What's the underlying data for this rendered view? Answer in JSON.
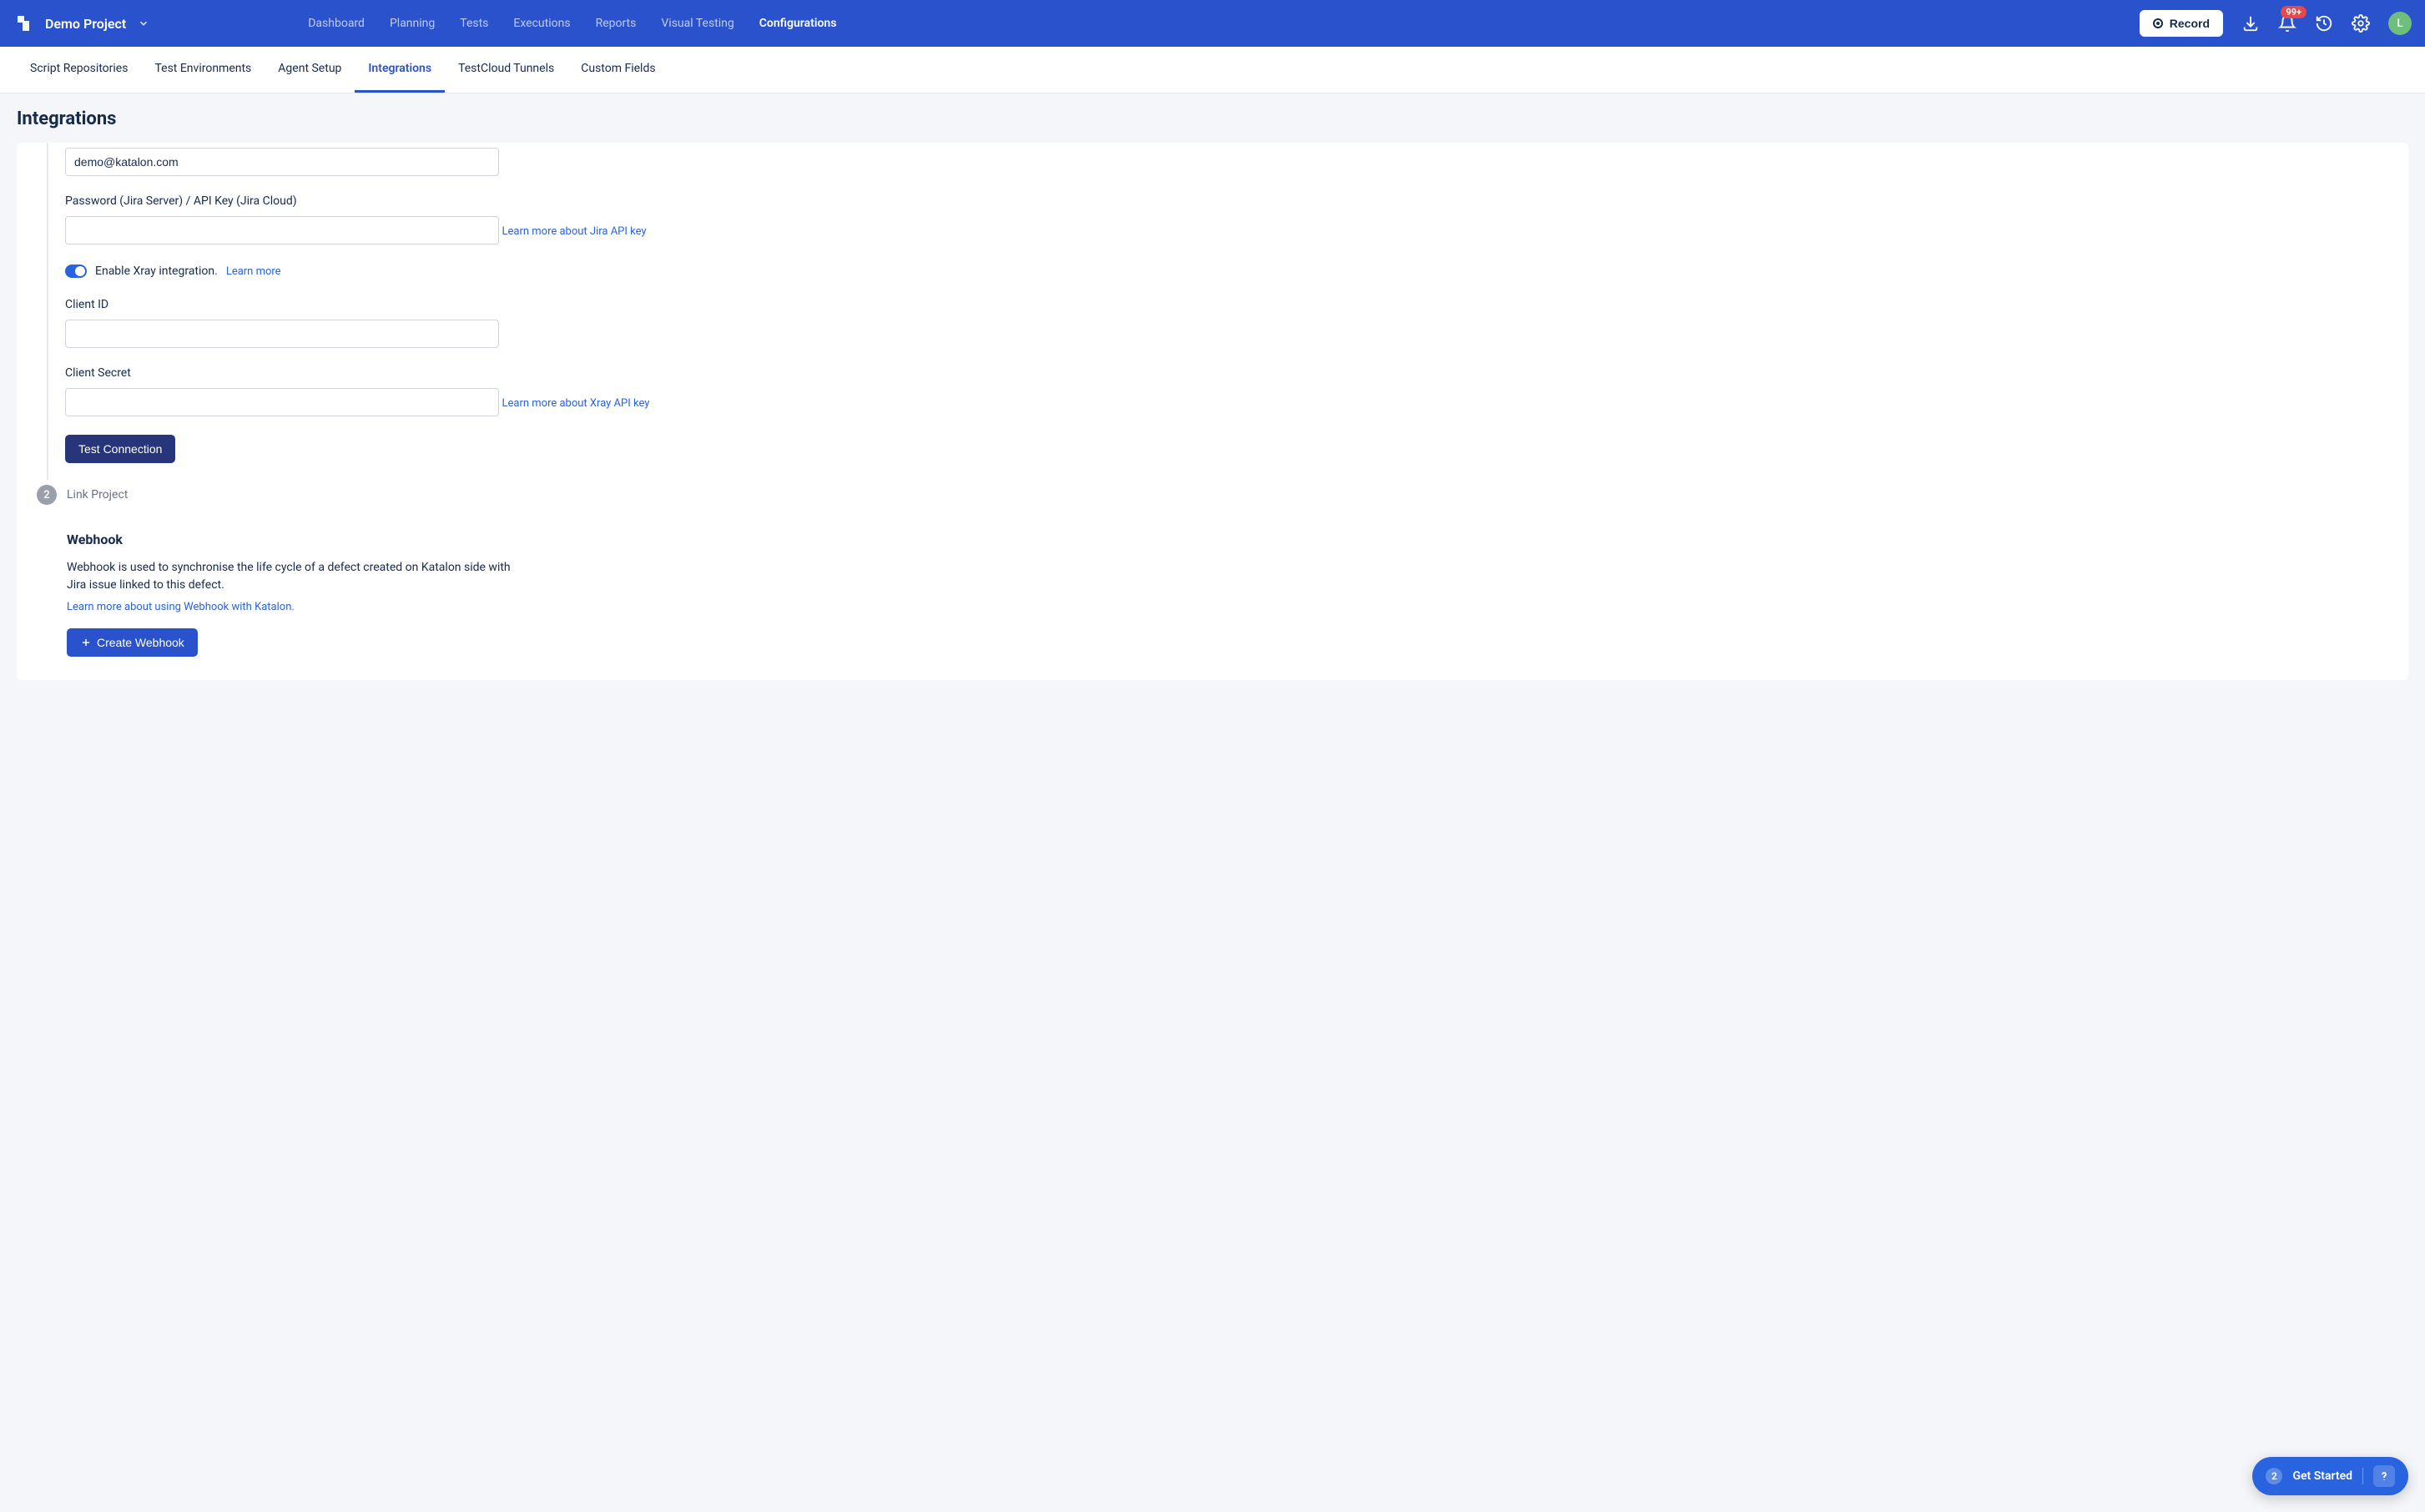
{
  "header": {
    "project_name": "Demo Project",
    "nav": [
      "Dashboard",
      "Planning",
      "Tests",
      "Executions",
      "Reports",
      "Visual Testing",
      "Configurations"
    ],
    "active_nav": "Configurations",
    "record_label": "Record",
    "notification_badge": "99+",
    "avatar_initial": "L"
  },
  "subtabs": {
    "items": [
      "Script Repositories",
      "Test Environments",
      "Agent Setup",
      "Integrations",
      "TestCloud Tunnels",
      "Custom Fields"
    ],
    "active": "Integrations"
  },
  "page": {
    "title": "Integrations"
  },
  "form": {
    "email_value": "demo@katalon.com",
    "password_label": "Password (Jira Server) / API Key (Jira Cloud)",
    "password_value": "",
    "jira_api_link": "Learn more about Jira API key",
    "xray_toggle_label": "Enable Xray integration.",
    "xray_learn_more": "Learn more",
    "client_id_label": "Client ID",
    "client_id_value": "",
    "client_secret_label": "Client Secret",
    "client_secret_value": "",
    "xray_api_link": "Learn more about Xray API key",
    "test_connection_label": "Test Connection"
  },
  "step2": {
    "number": "2",
    "title": "Link Project"
  },
  "webhook": {
    "heading": "Webhook",
    "description": "Webhook is used to synchronise the life cycle of a defect created on Katalon side with Jira issue linked to this defect.",
    "learn_link": "Learn more about using Webhook with Katalon.",
    "create_label": "Create Webhook"
  },
  "get_started": {
    "count": "2",
    "label": "Get Started"
  }
}
